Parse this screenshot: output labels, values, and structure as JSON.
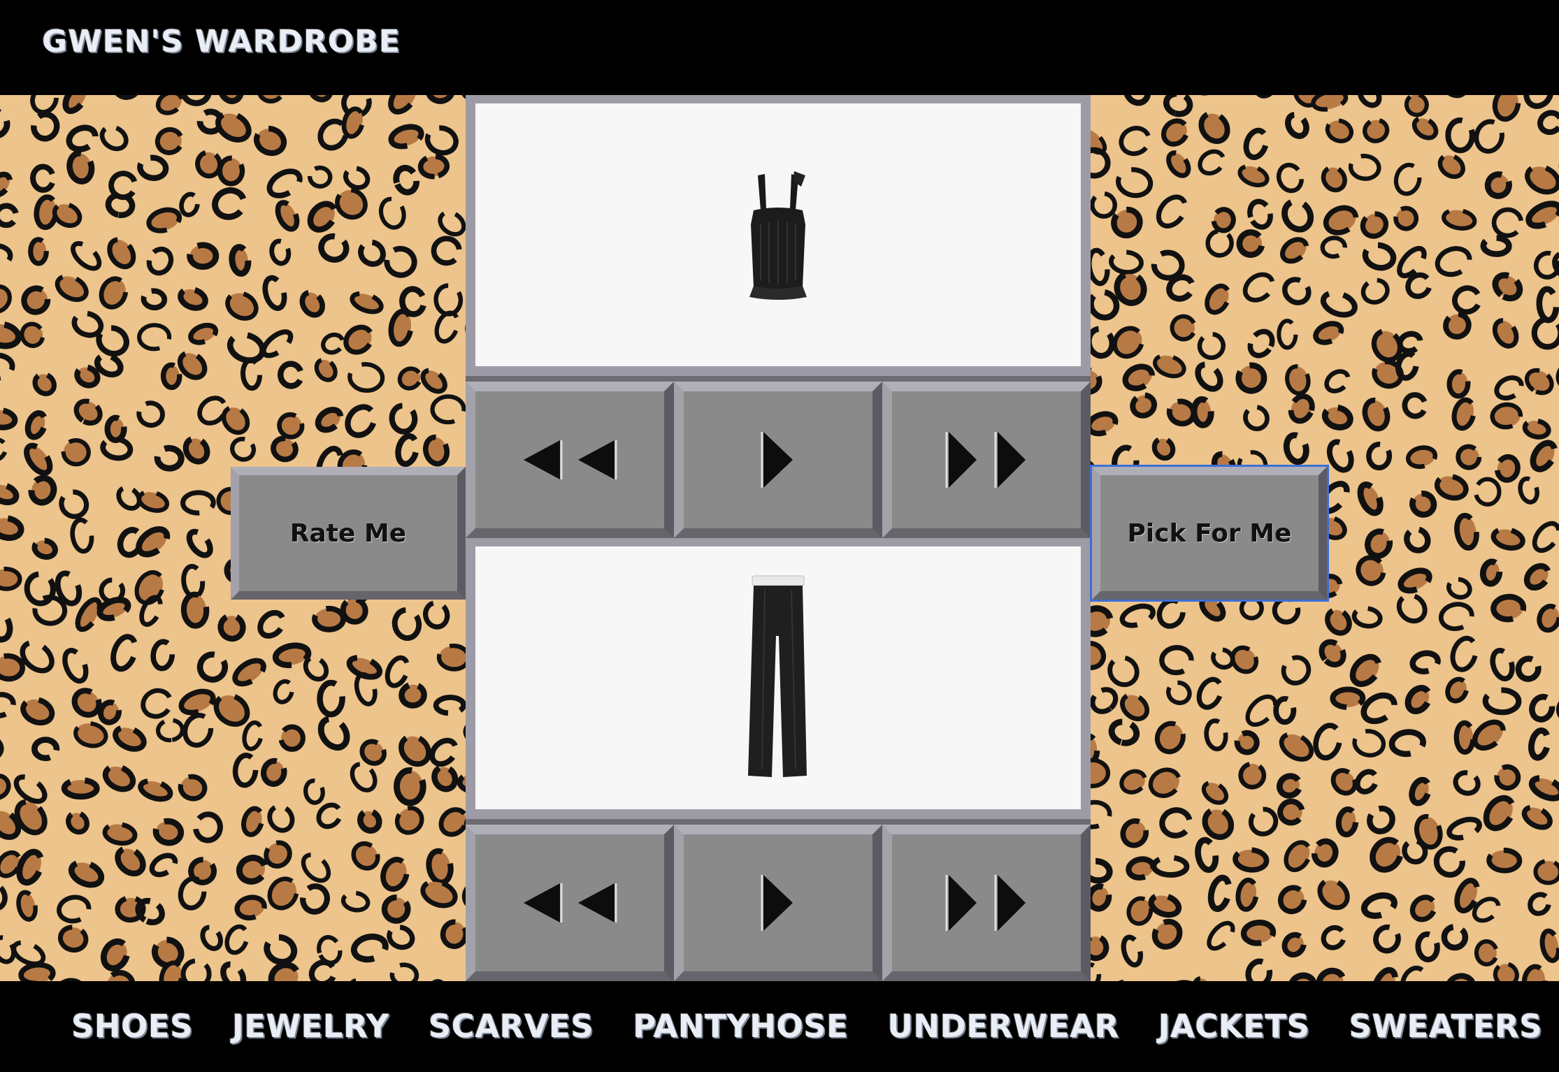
{
  "header": {
    "title": "GWEN'S WARDROBE"
  },
  "top_item": {
    "icon": "tank-top-icon",
    "prev_fast_icon": "double-left-triangle-icon",
    "play_icon": "right-triangle-icon",
    "next_fast_icon": "double-right-triangle-icon"
  },
  "bottom_item": {
    "icon": "trousers-icon",
    "prev_fast_icon": "double-left-triangle-icon",
    "play_icon": "right-triangle-icon",
    "next_fast_icon": "double-right-triangle-icon"
  },
  "actions": {
    "rate_label": "Rate Me",
    "pick_label": "Pick For Me"
  },
  "nav": {
    "items": [
      "SHOES",
      "JEWELRY",
      "SCARVES",
      "PANTYHOSE",
      "UNDERWEAR",
      "JACKETS",
      "SWEATERS"
    ]
  },
  "colors": {
    "background_pattern": "leopard",
    "base": "#ecc48c",
    "spot": "#111111",
    "spot_inner": "#b87a45",
    "button": "#8a8a8a",
    "selected_outline": "#3d6fd8"
  }
}
